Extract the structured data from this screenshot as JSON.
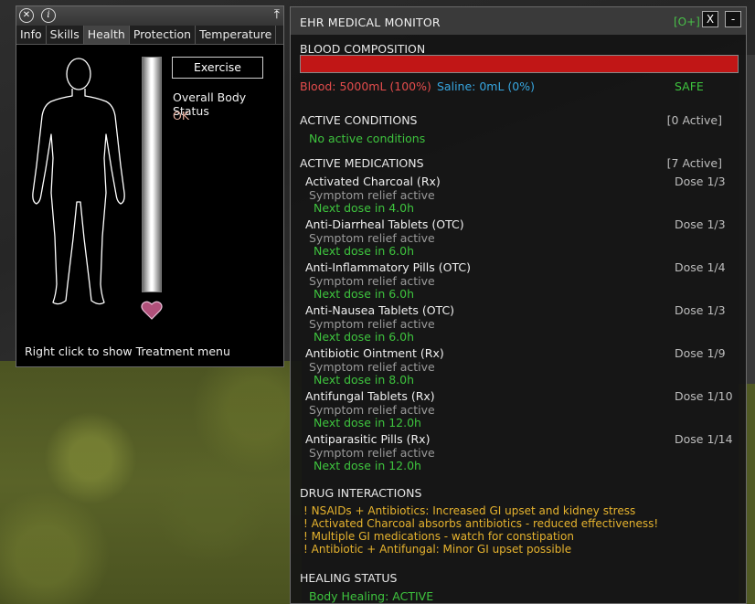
{
  "health_panel": {
    "tabs": [
      "Info",
      "Skills",
      "Health",
      "Protection",
      "Temperature"
    ],
    "active_tab": "Health",
    "exercise_label": "Exercise",
    "status_label": "Overall Body Status",
    "status_value": "OK",
    "hint": "Right click to show Treatment menu",
    "info_icon_glyph": "i",
    "close_icon_glyph": "✕",
    "pin_icon_glyph": "⤒",
    "icons": [
      "close-icon",
      "info-icon",
      "pin-icon",
      "heart-icon"
    ]
  },
  "monitor": {
    "title": "EHR MEDICAL MONITOR",
    "expand_label": "[O+]",
    "close_label": "X",
    "minimize_label": "-",
    "blood": {
      "heading": "BLOOD COMPOSITION",
      "blood_text": "Blood: 5000mL (100%)",
      "saline_text": "Saline: 0mL (0%)",
      "safety": "SAFE",
      "blood_fraction": 1.0,
      "bar_color": "#c11616"
    },
    "conditions": {
      "heading": "ACTIVE CONDITIONS",
      "count": "[0 Active]",
      "empty_text": "No active conditions"
    },
    "medications": {
      "heading": "ACTIVE MEDICATIONS",
      "count": "[7 Active]",
      "items": [
        {
          "name": "Activated Charcoal (Rx)",
          "dose": "Dose 1/3",
          "status": "Symptom relief active",
          "next": "Next dose in 4.0h"
        },
        {
          "name": "Anti-Diarrheal Tablets (OTC)",
          "dose": "Dose 1/3",
          "status": "Symptom relief active",
          "next": "Next dose in 6.0h"
        },
        {
          "name": "Anti-Inflammatory Pills (OTC)",
          "dose": "Dose 1/4",
          "status": "Symptom relief active",
          "next": "Next dose in 6.0h"
        },
        {
          "name": "Anti-Nausea Tablets (OTC)",
          "dose": "Dose 1/3",
          "status": "Symptom relief active",
          "next": "Next dose in 6.0h"
        },
        {
          "name": "Antibiotic Ointment (Rx)",
          "dose": "Dose 1/9",
          "status": "Symptom relief active",
          "next": "Next dose in 8.0h"
        },
        {
          "name": "Antifungal Tablets (Rx)",
          "dose": "Dose 1/10",
          "status": "Symptom relief active",
          "next": "Next dose in 12.0h"
        },
        {
          "name": "Antiparasitic Pills (Rx)",
          "dose": "Dose 1/14",
          "status": "Symptom relief active",
          "next": "Next dose in 12.0h"
        }
      ]
    },
    "interactions": {
      "heading": "DRUG INTERACTIONS",
      "items": [
        "! NSAIDs + Antibiotics: Increased GI upset and kidney stress",
        "! Activated Charcoal absorbs antibiotics - reduced effectiveness!",
        "! Multiple GI medications - watch for constipation",
        "! Antibiotic + Antifungal: Minor GI upset possible"
      ]
    },
    "healing": {
      "heading": "HEALING STATUS",
      "text": "Body Healing: ACTIVE"
    }
  }
}
